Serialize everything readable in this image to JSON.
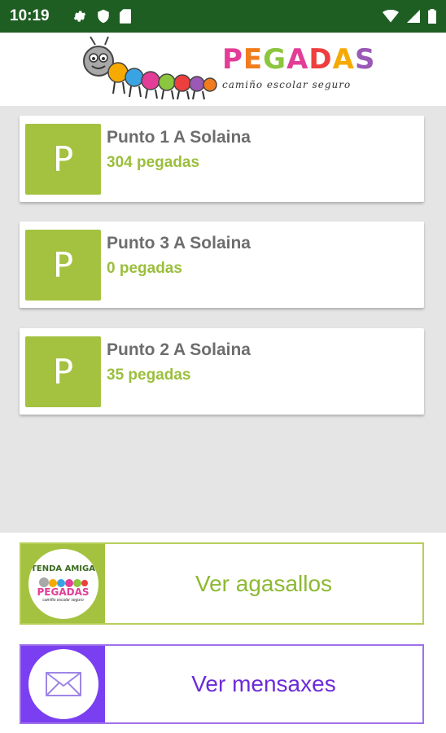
{
  "status_bar": {
    "time": "10:19",
    "left_icons": [
      "gear-icon",
      "shield-icon",
      "sd-card-icon"
    ],
    "right_icons": [
      "wifi-icon",
      "signal-icon",
      "battery-icon"
    ],
    "color": "#1f5e22"
  },
  "header": {
    "logo_letters": [
      "P",
      "E",
      "G",
      "A",
      "D",
      "A",
      "S"
    ],
    "logo_subtitle": "camiño escolar seguro"
  },
  "points": [
    {
      "badge": "P",
      "name": "Punto 1 A Solaina",
      "count": "304 pegadas"
    },
    {
      "badge": "P",
      "name": "Punto 3 A Solaina",
      "count": "0 pegadas"
    },
    {
      "badge": "P",
      "name": "Punto 2 A Solaina",
      "count": "35 pegadas"
    }
  ],
  "actions": {
    "gifts": {
      "label": "Ver agasallos",
      "badge_line1": "TENDA AMIGA",
      "badge_line2": "PEGADAS",
      "badge_line3": "camiño escolar seguro"
    },
    "messages": {
      "label": "Ver mensaxes",
      "icon": "envelope-icon"
    }
  },
  "colors": {
    "point_badge": "#a4c23f",
    "point_count": "#9bbf3c",
    "gifts_accent": "#a4c23f",
    "messages_accent": "#7a3ff0"
  }
}
